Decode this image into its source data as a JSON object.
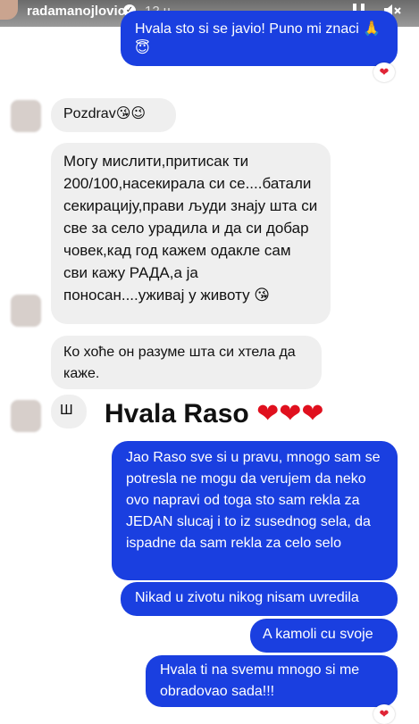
{
  "header": {
    "username": "radamanojlovic",
    "time": "12 ч"
  },
  "messages": {
    "m1": "Hvala sto si se javio! Puno mi znaci 🙏😇",
    "m2": "Pozdrav😘😉",
    "m3": "Могу мислити,притисак ти 200/100,насекирала си се....батали секирацију,прави људи знају шта си све за село урадила и да си добар човек,кад год кажем одакле сам сви кажу РАДА,а ја поносан....уживај у животу 😘",
    "m4": "Ко хоће он разуме шта си хтела да каже.",
    "m5": "Ш",
    "m6": "Jao Raso sve si u pravu, mnogo sam se potresla ne mogu da verujem da neko ovo napravi od toga sto sam rekla za JEDAN slucaj i to iz susednog sela, da ispadne da sam rekla za celo selo",
    "m7": "Nikad u zivotu nikog nisam uvredila",
    "m8": "A kamoli cu svoje",
    "m9": "Hvala ti na svemu mnogo si me obradovao sada!!!"
  },
  "overlay": {
    "text": "Hvala Raso",
    "hearts": "❤❤❤"
  },
  "reaction": "❤",
  "colors": {
    "outgoing_bubble": "#1a3fe0",
    "incoming_bubble": "#efefef",
    "heart": "#e02436"
  }
}
